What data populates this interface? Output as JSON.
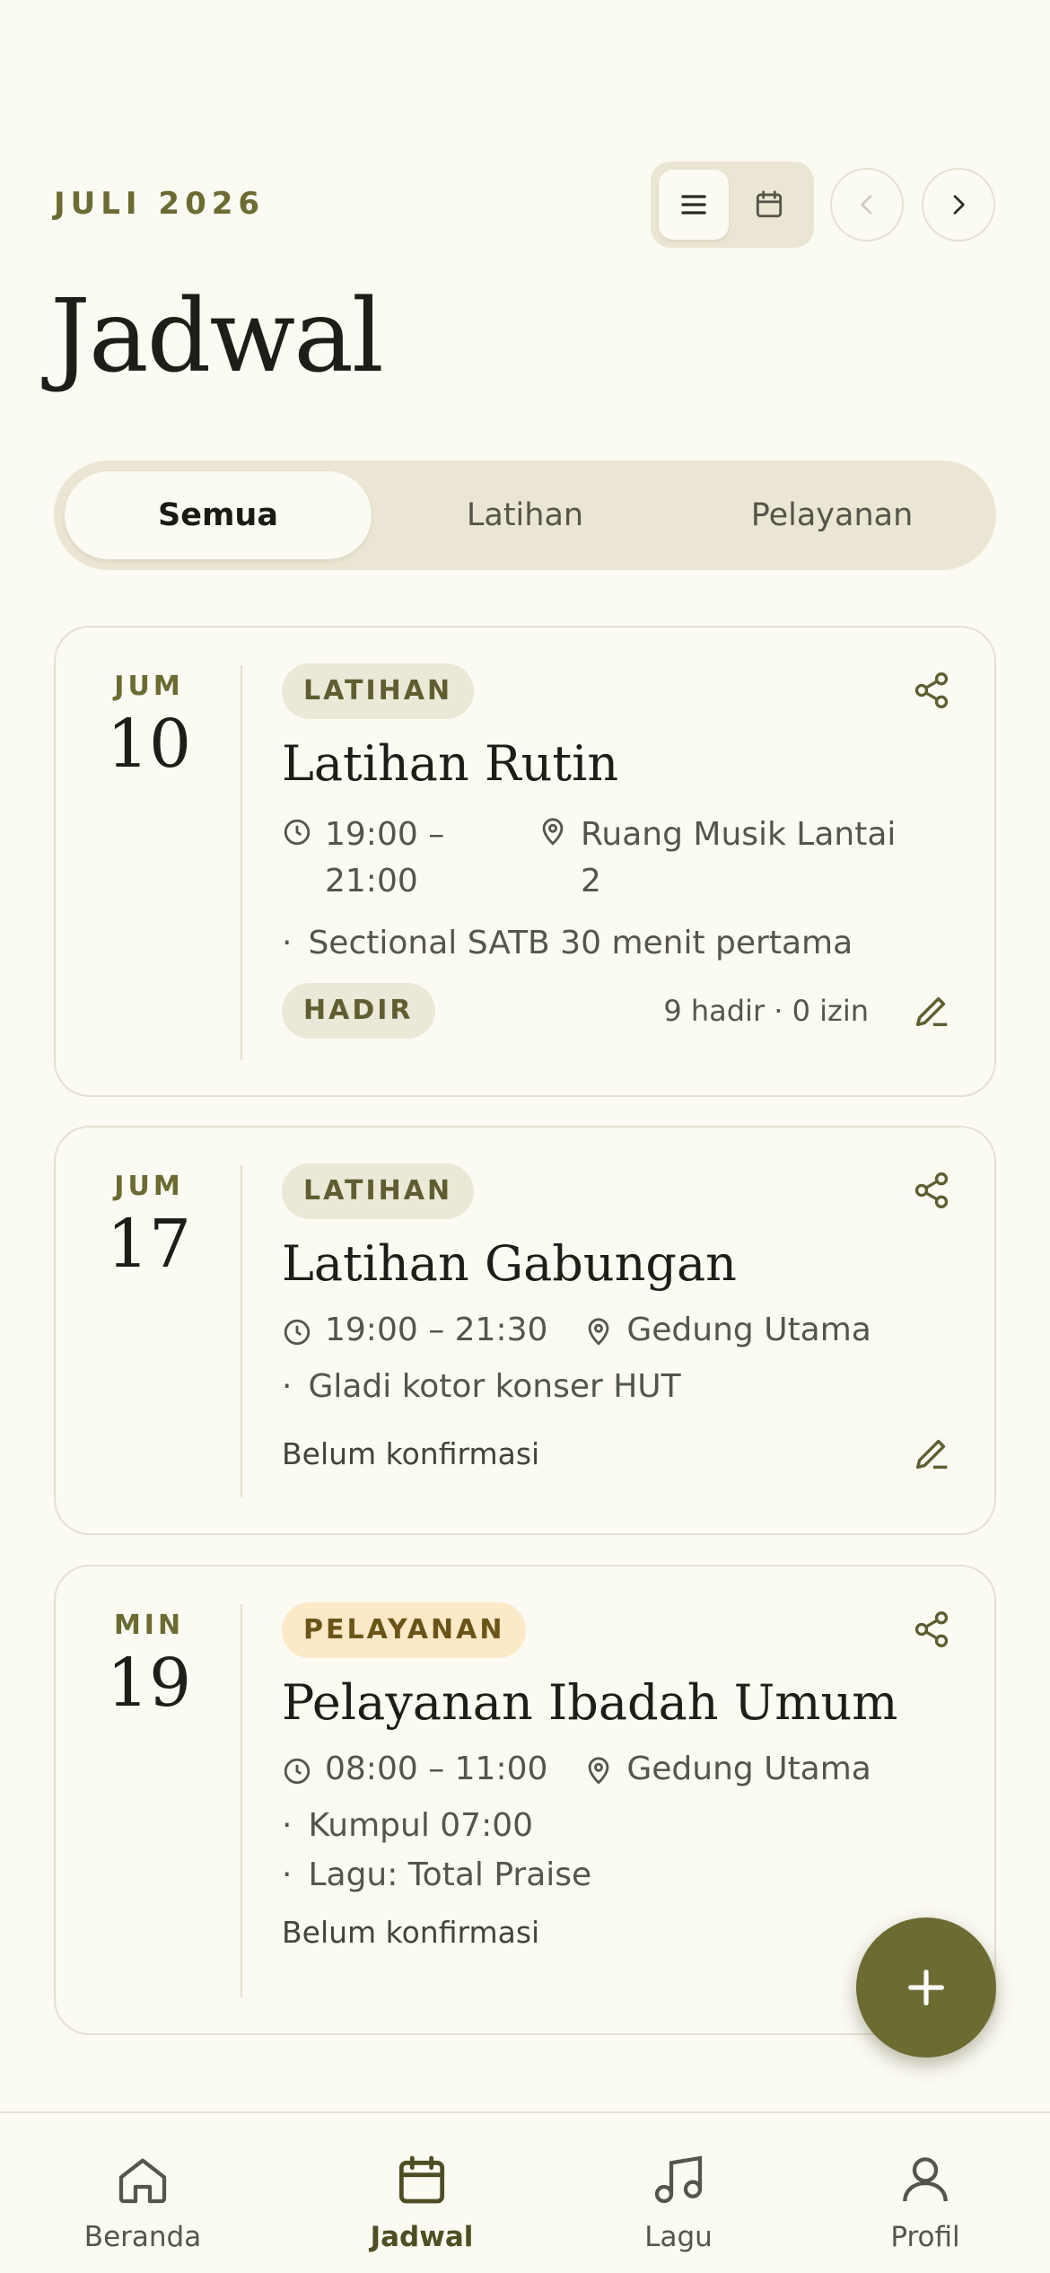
{
  "header": {
    "month": "JULI 2026",
    "title": "Jadwal"
  },
  "segments": [
    "Semua",
    "Latihan",
    "Pelayanan"
  ],
  "events": [
    {
      "dow": "JUM",
      "day": "10",
      "badge": "LATIHAN",
      "title": "Latihan Rutin",
      "time": "19:00 – 21:00",
      "location": "Ruang Musik Lantai 2",
      "notes": [
        "Sectional SATB 30 menit pertama"
      ],
      "status": "HADIR",
      "stats": "9 hadir · 0 izin"
    },
    {
      "dow": "JUM",
      "day": "17",
      "badge": "LATIHAN",
      "title": "Latihan Gabungan",
      "time": "19:00 – 21:30",
      "location": "Gedung Utama",
      "notes": [
        "Gladi kotor konser HUT"
      ],
      "status": "Belum konfirmasi"
    },
    {
      "dow": "MIN",
      "day": "19",
      "badge": "PELAYANAN",
      "title": "Pelayanan Ibadah Umum",
      "time": "08:00 – 11:00",
      "location": "Gedung Utama",
      "notes": [
        "Kumpul 07:00",
        "Lagu: Total Praise"
      ],
      "status": "Belum konfirmasi"
    }
  ],
  "bottom_nav": [
    "Beranda",
    "Jadwal",
    "Lagu",
    "Profil"
  ],
  "colors": {
    "accent": "#6b6b32",
    "background": "#fbfaf3",
    "pelayanan_badge": "#fbe9c8"
  }
}
